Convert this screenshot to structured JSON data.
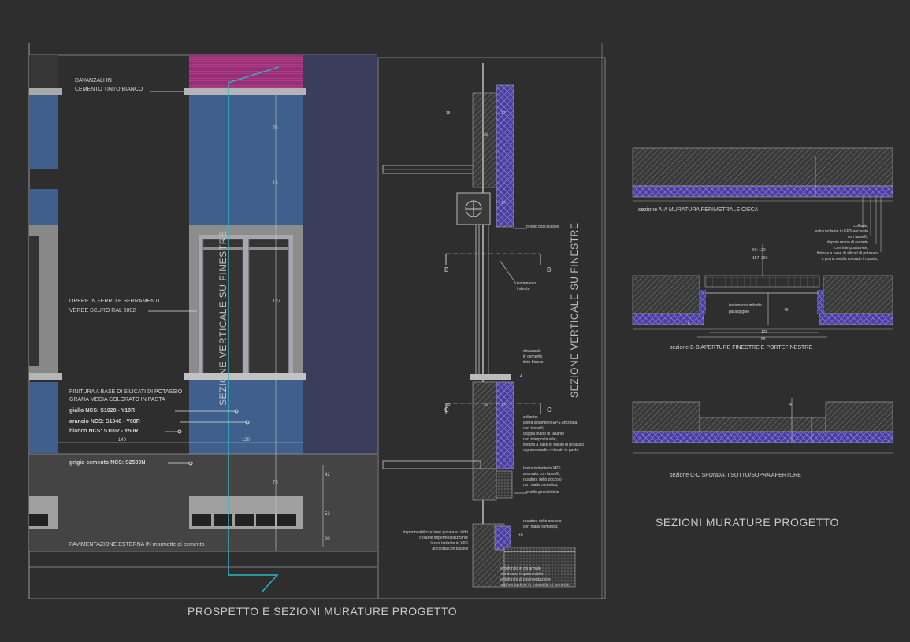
{
  "colors": {
    "background": "#2e2e2e",
    "wall_blue": "#3f5f8c",
    "column_navy": "#3a3d5c",
    "magenta": "#a0307a",
    "grey_frame": "#8c8c8c",
    "grey_base": "#444444",
    "cyan_cut_line": "#2fb8c4",
    "insulation_purple": "#5a4fb0"
  },
  "titles": {
    "left": "PROSPETTO E SEZIONI MURATURE PROGETTO",
    "right": "SEZIONI MURATURE PROGETTO",
    "vertical_section": "SEZIONE VERTICALE SU FINESTRE"
  },
  "elevation": {
    "davanzali": [
      "DAVANZALI IN",
      "CEMENTO TINTO BIANCO"
    ],
    "opere": [
      "OPERE IN FERRO E SERRAMENTI",
      "VERDE SCURO RAL 6002"
    ],
    "finitura": [
      "FINITURA A BASE DI SILICATI DI POTASSIO",
      "GRANA MEDIA COLORATO IN PASTA"
    ],
    "colors_list": [
      "giallo   NCS: S1020 - Y10R",
      "arancio NCS: S1040 - Y60R",
      "bianco  NCS: S1002 - Y50R"
    ],
    "grigio": "grigio cemento   NCS: S2500N",
    "pavimentazione": "PAVIMENTAZIONE ESTERNA IN marmette di cemento",
    "dims": {
      "d140": "140",
      "d120": "120",
      "d137": "137",
      "d42": "42",
      "d53": "53",
      "d20": "20",
      "d75": "75",
      "d15": "15",
      "d75b": "75"
    }
  },
  "section": {
    "profilo_top": "profilo gocciolatoio",
    "isolamento": [
      "isolamento",
      "imbotte"
    ],
    "davanzale": [
      "davanzale",
      "in cemento",
      "tinto bianco"
    ],
    "collante": [
      "collante;",
      "lastra isolante in EPS ancorata",
      "con tasselli;",
      "doppia mano di rasante",
      "con interposta rete;",
      "finitura a base di silicati di potassio",
      "a grana media colorato in pasta;"
    ],
    "xps": [
      "lastra isolante in XPS",
      "ancorata con tasselli;",
      "rasatura dello zoccolo",
      "con malta osmotica;"
    ],
    "profilo_bottom": "profilo gocciolatoio",
    "rasatura": [
      "rasatura dello zoccolo",
      "con malta osmotica;"
    ],
    "impermeab": [
      "impermeabilizzazione posata a caldo",
      "collante impermeabilizzante",
      "lastra isolante in XPS",
      "ancorata con tasselli"
    ],
    "sottofondo": [
      "sottofondo in cls armato",
      "membrana impermeabile",
      "sottofondo di pavimentazione",
      "pavimentazione in marmette di cemento"
    ],
    "cut_b_left": "B",
    "cut_b_right": "B",
    "cut_c_left": "C",
    "cut_c_right": "C",
    "dims": {
      "d15": "15",
      "d20": "20",
      "d17": "17",
      "d17b": "17",
      "d15b": "15",
      "d20b": "20",
      "d17c": "17",
      "plus0": "±0",
      "d4": "4"
    }
  },
  "sections_right": {
    "aa": "sezione A-A    MURATURA PERIMETRALE CIECA",
    "bb": "sezione B-B    APERTURE FINESTRE E PORTEFINESTRE",
    "cc": "sezione C-C    SFONDATI SOTTO/SOPRA APERTURE",
    "collante": [
      "collante;",
      "lastra isolante in EPS ancorato",
      "con tasselli;",
      "doppia mano di rasante",
      "con interposta rete;",
      "finitura a base di silicati di potassio",
      "a grana media colorato in pasta;"
    ],
    "isol_imbotte": "isolamento imbotte",
    "paraspigolo": "paraspigolo",
    "dims": {
      "d60_120": "60÷120",
      "d157_250": "157÷250",
      "d40": "40",
      "d128": "128",
      "d68": "68",
      "d5": "5",
      "d4": "4"
    }
  }
}
